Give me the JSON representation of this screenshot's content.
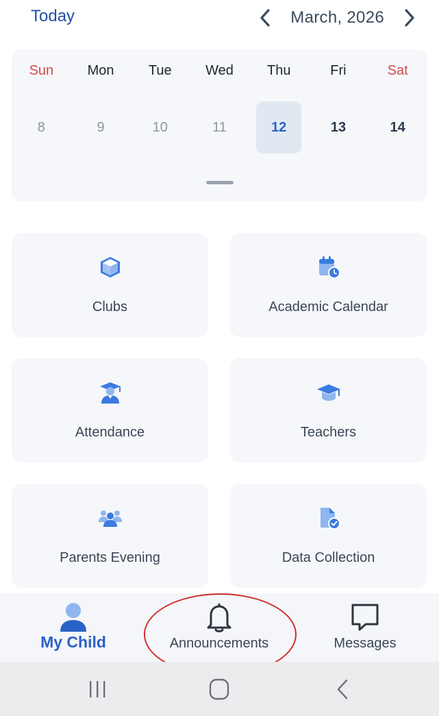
{
  "header": {
    "today_label": "Today",
    "month_label": "March, 2026",
    "prev_icon": "chevron-left-icon",
    "next_icon": "chevron-right-icon"
  },
  "calendar": {
    "weekdays": [
      "Sun",
      "Mon",
      "Tue",
      "Wed",
      "Thu",
      "Fri",
      "Sat"
    ],
    "dates": [
      "8",
      "9",
      "10",
      "11",
      "12",
      "13",
      "14"
    ],
    "selected_date": "12",
    "weekend_color": "#d44a4a",
    "selected_color": "#2b62c8"
  },
  "tiles": [
    {
      "label": "Clubs",
      "icon": "cube-icon"
    },
    {
      "label": "Academic Calendar",
      "icon": "calendar-clock-icon"
    },
    {
      "label": "Attendance",
      "icon": "graduate-icon"
    },
    {
      "label": "Teachers",
      "icon": "mortarboard-icon"
    },
    {
      "label": "Parents Evening",
      "icon": "group-icon"
    },
    {
      "label": "Data Collection",
      "icon": "document-check-icon"
    }
  ],
  "bottom_nav": {
    "items": [
      {
        "label": "My Child",
        "icon": "person-icon",
        "active": true
      },
      {
        "label": "Announcements",
        "icon": "bell-icon",
        "active": false
      },
      {
        "label": "Messages",
        "icon": "chat-icon",
        "active": false
      }
    ]
  },
  "system_nav": {
    "recents_icon": "recents-icon",
    "home_icon": "home-icon",
    "back_icon": "back-icon"
  },
  "colors": {
    "accent": "#1f4fa3",
    "icon_blue": "#3b7be0",
    "highlight": "#d12c2c"
  }
}
